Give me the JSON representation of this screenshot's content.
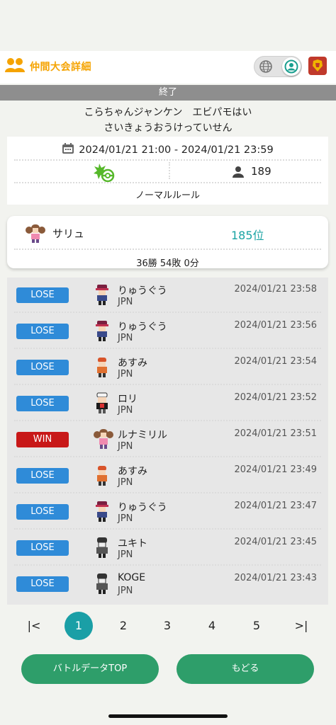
{
  "header": {
    "title": "仲間大会詳細",
    "icons": [
      "group-icon",
      "globe-icon",
      "profile-icon",
      "emblem-icon"
    ]
  },
  "status": "終了",
  "competition": {
    "name_line1": "こらちゃんジャンケン　エビパモはい",
    "name_line2": "さいきょうおうけっていせん",
    "date_range": "2024/01/21 21:00 - 2024/01/21 23:59",
    "players": "189",
    "rule": "ノーマルルール"
  },
  "player": {
    "name": "サリュ",
    "rank": "185位",
    "record": "36勝 54敗 0分"
  },
  "battles": [
    {
      "result": "LOSE",
      "opponent": "りゅうぐう",
      "country": "JPN",
      "time": "2024/01/21 23:58",
      "sprite": "trainer-red-hat"
    },
    {
      "result": "LOSE",
      "opponent": "りゅうぐう",
      "country": "JPN",
      "time": "2024/01/21 23:56",
      "sprite": "trainer-red-hat"
    },
    {
      "result": "LOSE",
      "opponent": "あすみ",
      "country": "JPN",
      "time": "2024/01/21 23:54",
      "sprite": "trainer-orange"
    },
    {
      "result": "LOSE",
      "opponent": "ロリ",
      "country": "JPN",
      "time": "2024/01/21 23:52",
      "sprite": "trainer-white-cap"
    },
    {
      "result": "WIN",
      "opponent": "ルナミリル",
      "country": "JPN",
      "time": "2024/01/21 23:51",
      "sprite": "trainer-pigtails"
    },
    {
      "result": "LOSE",
      "opponent": "あすみ",
      "country": "JPN",
      "time": "2024/01/21 23:49",
      "sprite": "trainer-orange"
    },
    {
      "result": "LOSE",
      "opponent": "りゅうぐう",
      "country": "JPN",
      "time": "2024/01/21 23:47",
      "sprite": "trainer-red-hat"
    },
    {
      "result": "LOSE",
      "opponent": "ユキト",
      "country": "JPN",
      "time": "2024/01/21 23:45",
      "sprite": "trainer-grey"
    },
    {
      "result": "LOSE",
      "opponent": "KOGE",
      "country": "JPN",
      "time": "2024/01/21 23:43",
      "sprite": "trainer-grey"
    }
  ],
  "pagination": {
    "first": "|<",
    "pages": [
      "1",
      "2",
      "3",
      "4",
      "5"
    ],
    "last": ">|",
    "current": "1"
  },
  "buttons": {
    "battle_top": "バトルデータTOP",
    "back": "もどる"
  },
  "colors": {
    "accent_orange": "#f5a300",
    "teal": "#1aa3a3",
    "lose": "#2f8bd8",
    "win": "#c81818",
    "button_green": "#2e9e6a"
  }
}
